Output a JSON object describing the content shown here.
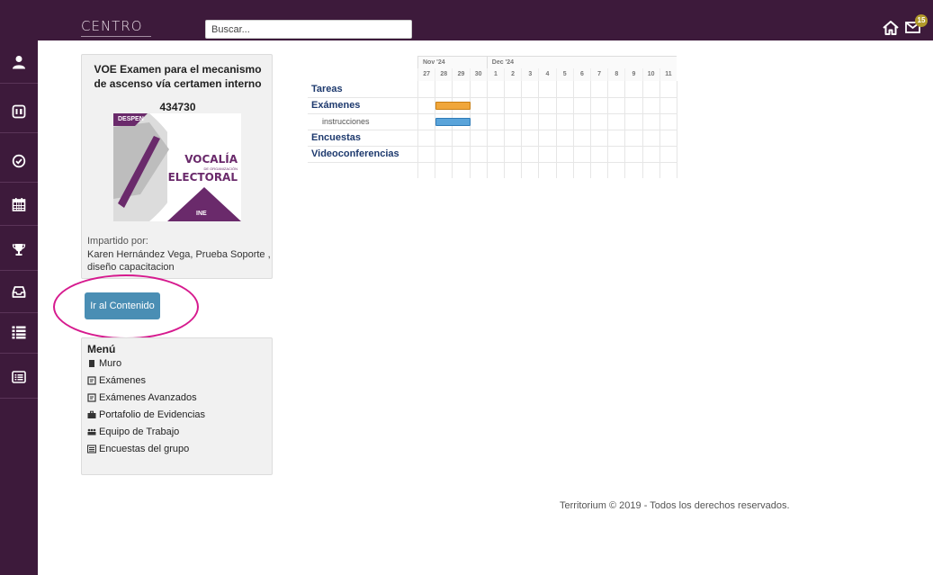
{
  "header": {
    "logo_text": "CENTRO",
    "search_placeholder": "Buscar...",
    "notification_count": "15",
    "icons": [
      "home-icon",
      "mail-icon"
    ]
  },
  "sidebar": {
    "items": [
      {
        "name": "user-icon"
      },
      {
        "name": "book-icon"
      },
      {
        "name": "check-circle-icon"
      },
      {
        "name": "calendar-icon"
      },
      {
        "name": "trophy-icon"
      },
      {
        "name": "inbox-icon"
      },
      {
        "name": "list-icon"
      },
      {
        "name": "list-alt-icon"
      }
    ]
  },
  "course": {
    "title": "VOE Examen para el mecanismo de ascenso vía certamen interno",
    "code": "434730",
    "image": {
      "tag": "DESPEN",
      "heading_1": "VOCALÍA",
      "heading_sub": "DE ORGANIZACIÓN",
      "heading_2": "ELECTORAL",
      "brand": "INE"
    },
    "taught_by_label": "Impartido por:",
    "taught_by": "Karen Hernández Vega, Prueba Soporte , diseño capacitacion"
  },
  "content_button": "Ir al Contenido",
  "menu": {
    "title": "Menú",
    "items": [
      {
        "label": "Muro",
        "icon": "wall-icon"
      },
      {
        "label": "Exámenes",
        "icon": "exam-icon"
      },
      {
        "label": "Exámenes Avanzados",
        "icon": "exam-icon"
      },
      {
        "label": "Portafolio de Evidencias",
        "icon": "briefcase-icon"
      },
      {
        "label": "Equipo de Trabajo",
        "icon": "team-icon"
      },
      {
        "label": "Encuestas del grupo",
        "icon": "survey-icon"
      }
    ]
  },
  "gantt": {
    "months": [
      {
        "label": "Nov '24",
        "start_index": 0,
        "span": 4
      },
      {
        "label": "Dec '24",
        "start_index": 4,
        "span": 11
      }
    ],
    "days": [
      "27",
      "28",
      "29",
      "30",
      "1",
      "2",
      "3",
      "4",
      "5",
      "6",
      "7",
      "8",
      "9",
      "10",
      "11"
    ],
    "rows": [
      {
        "label": "Tareas",
        "type": "group"
      },
      {
        "label": "Exámenes",
        "type": "group"
      },
      {
        "label": "instrucciones",
        "type": "task"
      },
      {
        "label": "Encuestas",
        "type": "group"
      },
      {
        "label": "Videoconferencias",
        "type": "group"
      }
    ],
    "bars": [
      {
        "row": 1,
        "start_day": "28",
        "end_day": "29",
        "color": "#f0a63a"
      },
      {
        "row": 2,
        "start_day": "28",
        "end_day": "29",
        "color": "#5aa4da"
      }
    ]
  },
  "footer": "Territorium © 2019 - Todos los derechos reservados.",
  "colors": {
    "brand": "#3d1a3b",
    "button": "#4a8eb4",
    "highlight": "#d61a8e"
  }
}
